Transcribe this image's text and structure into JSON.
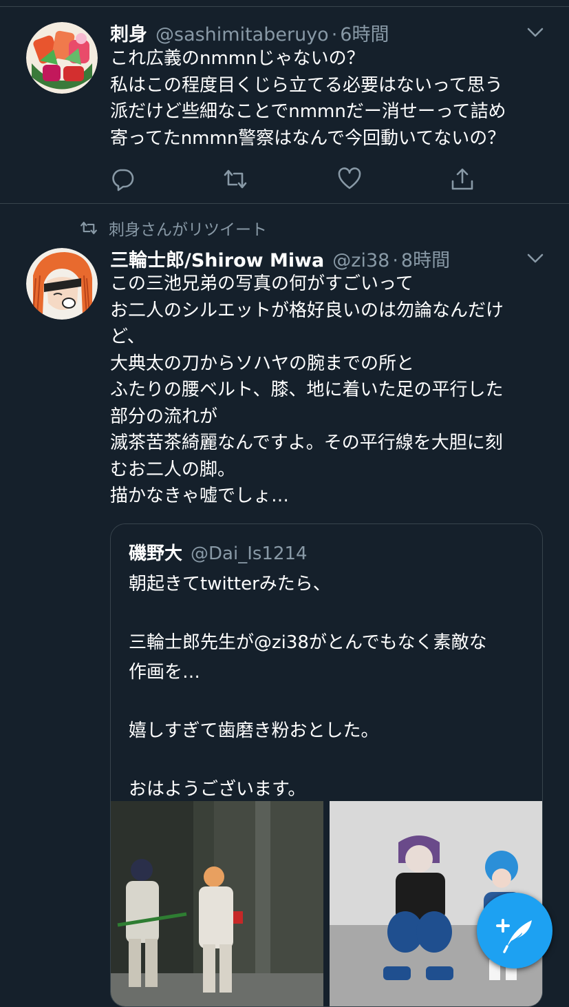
{
  "tweets": [
    {
      "name": "刺身",
      "handle": "@sashimitaberuyo",
      "separator": "·",
      "time": "6時間",
      "text": "これ広義のnmmnじゃないの？\n私はこの程度目くじら立てる必要はないって思う\n派だけど些細なことでnmmnだー消せーって詰め\n寄ってたnmmn警察はなんで今回動いてないの？",
      "avatar_icon": "sashimi-avatar-icon"
    },
    {
      "retweet_label": "刺身さんがリツイート",
      "name": "三輪士郎/Shirow Miwa",
      "handle": "@zi38",
      "separator": "·",
      "time": "8時間",
      "text": "この三池兄弟の写真の何がすごいって\nお二人のシルエットが格好良いのは勿論なんだけ\nど、\n大典太の刀からソハヤの腕までの所と\nふたりの腰ベルト、膝、地に着いた足の平行した\n部分の流れが\n滅茶苦茶綺麗なんですよ。その平行線を大胆に刻\nむお二人の脚。\n描かなきゃ嘘でしょ…",
      "avatar_icon": "illustrated-character-avatar-icon"
    }
  ],
  "quoted_tweet": {
    "name": "磯野大",
    "handle": "@Dai_Is1214",
    "text": "朝起きてtwitterみたら、\n\n三輪士郎先生が@zi38がとんでもなく素敵な\n作画を…\n\n嬉しすぎて歯磨き粉おとした。\n\nおはようございます。",
    "images": [
      "cosplay-photo-1",
      "cosplay-photo-2"
    ]
  },
  "icons": {
    "reply": "reply-icon",
    "retweet": "retweet-icon",
    "like": "heart-icon",
    "share": "share-icon",
    "more": "chevron-down-icon",
    "compose": "compose-tweet-icon"
  },
  "colors": {
    "background": "#15202b",
    "secondary_text": "#8899a6",
    "divider": "#38444d",
    "accent": "#1da1f2"
  }
}
